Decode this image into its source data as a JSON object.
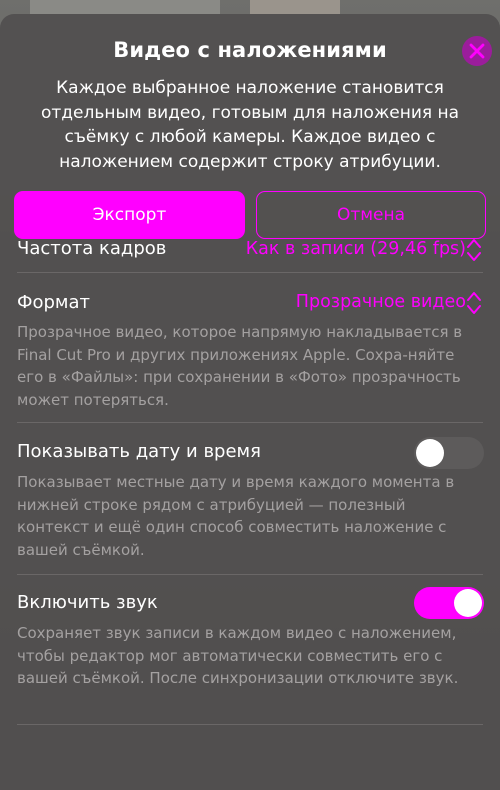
{
  "dialog": {
    "title": "Видео с наложениями",
    "subtitle": "Каждое выбранное наложение становится отдельным видео, готовым для наложения на съёмку с любой камеры. Каждое видео с наложением содержит строку атрибуции."
  },
  "buttons": {
    "export_label": "Экспорт",
    "cancel_label": "Отмена"
  },
  "settings": {
    "framerate": {
      "label": "Частота кадров",
      "value": "Как в записи (29,46 fps)"
    },
    "format": {
      "label": "Формат",
      "value": "Прозрачное видео",
      "description": "Прозрачное видео, которое напрямую накладывается в Final Cut Pro и других приложениях Apple. Сохра-няйте его в «Файлы»: при сохранении в «Фото» прозрачность может потеряться."
    },
    "datetime": {
      "label": "Показывать дату и время",
      "enabled": false,
      "description": "Показывает местные дату и время каждого момента в нижней строке рядом с атрибуцией — полезный контекст и ещё один способ совместить наложение с вашей съёмкой."
    },
    "sound": {
      "label": "Включить звук",
      "enabled": true,
      "description": "Сохраняет звук записи в каждом видео с наложением, чтобы редактор мог автоматически совместить его с вашей съёмкой. После синхронизации отключите звук."
    }
  },
  "colors": {
    "accent": "#ff00ff",
    "close_button": "#9b1d9b",
    "sheet": "#525050",
    "secondary_text": "#a4a1a1"
  },
  "icons": {
    "close": "close-icon",
    "chevron": "chevron-up-down-icon"
  }
}
